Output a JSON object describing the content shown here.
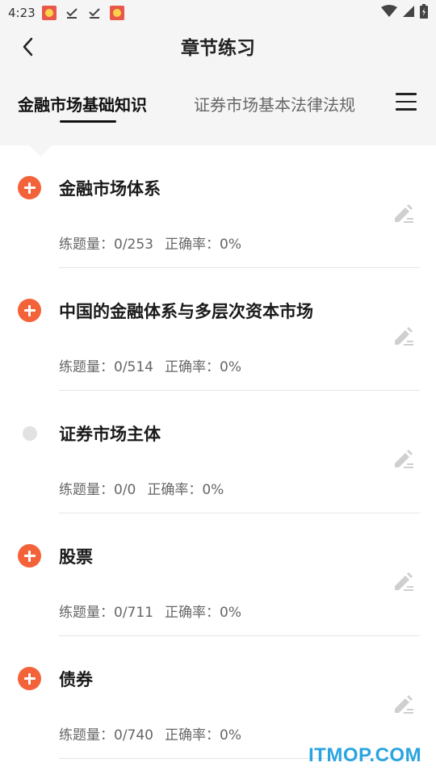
{
  "status_bar": {
    "time": "4:23",
    "icons": [
      "app-notification-icon",
      "download-done-icon",
      "download-done-icon",
      "app-notification-icon"
    ],
    "right_icons": [
      "wifi-icon",
      "signal-icon",
      "battery-icon"
    ]
  },
  "header": {
    "title": "章节练习",
    "back_icon": "chevron-left-icon"
  },
  "tabs": {
    "items": [
      {
        "label": "金融市场基础知识",
        "active": true
      },
      {
        "label": "证券市场基本法律法规",
        "active": false
      }
    ],
    "menu_icon": "hamburger-menu-icon"
  },
  "chapters": [
    {
      "title": "金融市场体系",
      "questions_label": "练题量：",
      "questions": "0/253",
      "accuracy_label": "正确率：",
      "accuracy": "0%",
      "expandable": true
    },
    {
      "title": "中国的金融体系与多层次资本市场",
      "questions_label": "练题量：",
      "questions": "0/514",
      "accuracy_label": "正确率：",
      "accuracy": "0%",
      "expandable": true
    },
    {
      "title": "证券市场主体",
      "questions_label": "练题量：",
      "questions": "0/0",
      "accuracy_label": "正确率：",
      "accuracy": "0%",
      "expandable": false
    },
    {
      "title": "股票",
      "questions_label": "练题量：",
      "questions": "0/711",
      "accuracy_label": "正确率：",
      "accuracy": "0%",
      "expandable": true
    },
    {
      "title": "债券",
      "questions_label": "练题量：",
      "questions": "0/740",
      "accuracy_label": "正确率：",
      "accuracy": "0%",
      "expandable": true
    }
  ],
  "colors": {
    "accent": "#f4623a",
    "background_header": "#f5f5f5",
    "disabled_dot": "#e2e2e2",
    "watermark": "#2aa4e0"
  },
  "watermark": "ITMOP.COM"
}
